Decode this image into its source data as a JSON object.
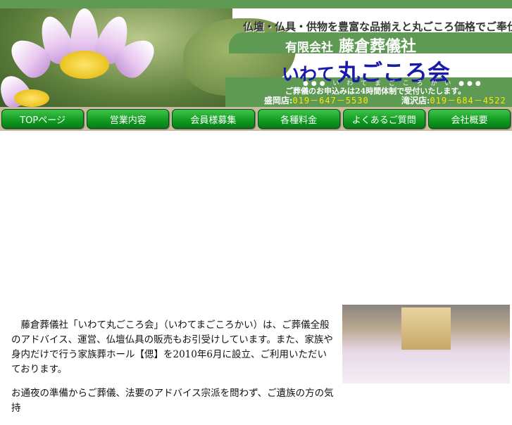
{
  "header": {
    "tagline": "仏壇・仏具・供物を豊富な品揃えと丸ごころ価格でご奉仕",
    "company_prefix": "有限会社",
    "company_name": "藤倉葬儀社",
    "brand_prefix": "いわて",
    "brand_name": "丸ごころ会",
    "brand_kana": "●●● い わ て ま ご こ ろ か い ●●●",
    "reception": "ご葬儀のお申込みは24時間体制で受付いたします。",
    "stores": [
      {
        "name": "盛岡店:",
        "tel": "019－647－5530"
      },
      {
        "name": "滝沢店:",
        "tel": "019－684－4522"
      }
    ]
  },
  "nav": [
    "TOPページ",
    "営業内容",
    "会員様募集",
    "各種料金",
    "よくあるご質問",
    "会社概要"
  ],
  "intro": [
    "藤倉葬儀社「いわて丸ごころ会」（いわてまごころかい）は、ご葬儀全般のアドバイス、運営、仏壇仏具の販売もお引受けしています。また、家族や身内だけで行う家族葬ホール【偲】を2010年6月に設立、ご利用いただいております。",
    "お通夜の準備からご葬儀、法要のアドバイス宗派を問わず、ご遺族の方の気持"
  ]
}
